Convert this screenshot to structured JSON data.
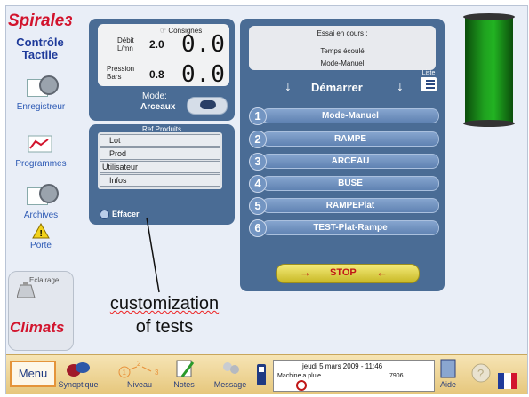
{
  "app": {
    "logo": "Spirale",
    "logo_suffix": "3",
    "subtitle_line1": "Contrôle",
    "subtitle_line2": "Tactile"
  },
  "sidebar": {
    "items": [
      {
        "label": "Enregistreur",
        "icon": "recorder-icon"
      },
      {
        "label": "Programmes",
        "icon": "programs-icon"
      },
      {
        "label": "Archives",
        "icon": "archives-icon"
      },
      {
        "label": "Porte",
        "icon": "warning-icon"
      }
    ],
    "eclairage_label": "Eclairage",
    "brand": "Climats"
  },
  "consignes": {
    "title": "Consignes",
    "debit_label_1": "Débit",
    "debit_label_2": "L/mn",
    "debit_setpoint": "2.0",
    "debit_value": "0.0",
    "pression_label_1": "Pression",
    "pression_label_2": "Bars",
    "pression_setpoint": "0.8",
    "pression_value": "0.0",
    "mode_label": "Mode:",
    "mode_value": "Arceaux"
  },
  "ref_produits": {
    "title": "Ref Produits",
    "fields": [
      "Lot",
      "Prod",
      "Utilisateur",
      "Infos"
    ],
    "effacer": "Effacer"
  },
  "essai": {
    "en_cours": "Essai en cours :",
    "temps": "Temps écoulé",
    "mode": "Mode-Manuel",
    "demarrer": "Démarrer",
    "liste": "Liste",
    "programs": [
      {
        "num": "1",
        "label": "Mode-Manuel"
      },
      {
        "num": "2",
        "label": "RAMPE"
      },
      {
        "num": "3",
        "label": "ARCEAU"
      },
      {
        "num": "4",
        "label": "BUSE"
      },
      {
        "num": "5",
        "label": "RAMPEPlat"
      },
      {
        "num": "6",
        "label": "TEST-Plat-Rampe"
      }
    ],
    "stop": "STOP"
  },
  "annotation": {
    "line1": "customization",
    "line2": "of tests"
  },
  "taskbar": {
    "menu": "Menu",
    "items": [
      "Synoptique",
      "Niveau",
      "Notes",
      "Message"
    ],
    "niveau_digits": [
      "1",
      "2",
      "3"
    ],
    "status_date": "jeudi 5 mars 2009 - 11:46",
    "status_machine": "Machine a pluie",
    "status_code": "7906",
    "aide": "Aide"
  },
  "colors": {
    "panel": "#4a6c95",
    "accent_red": "#d2142d",
    "light": "#22b322"
  }
}
